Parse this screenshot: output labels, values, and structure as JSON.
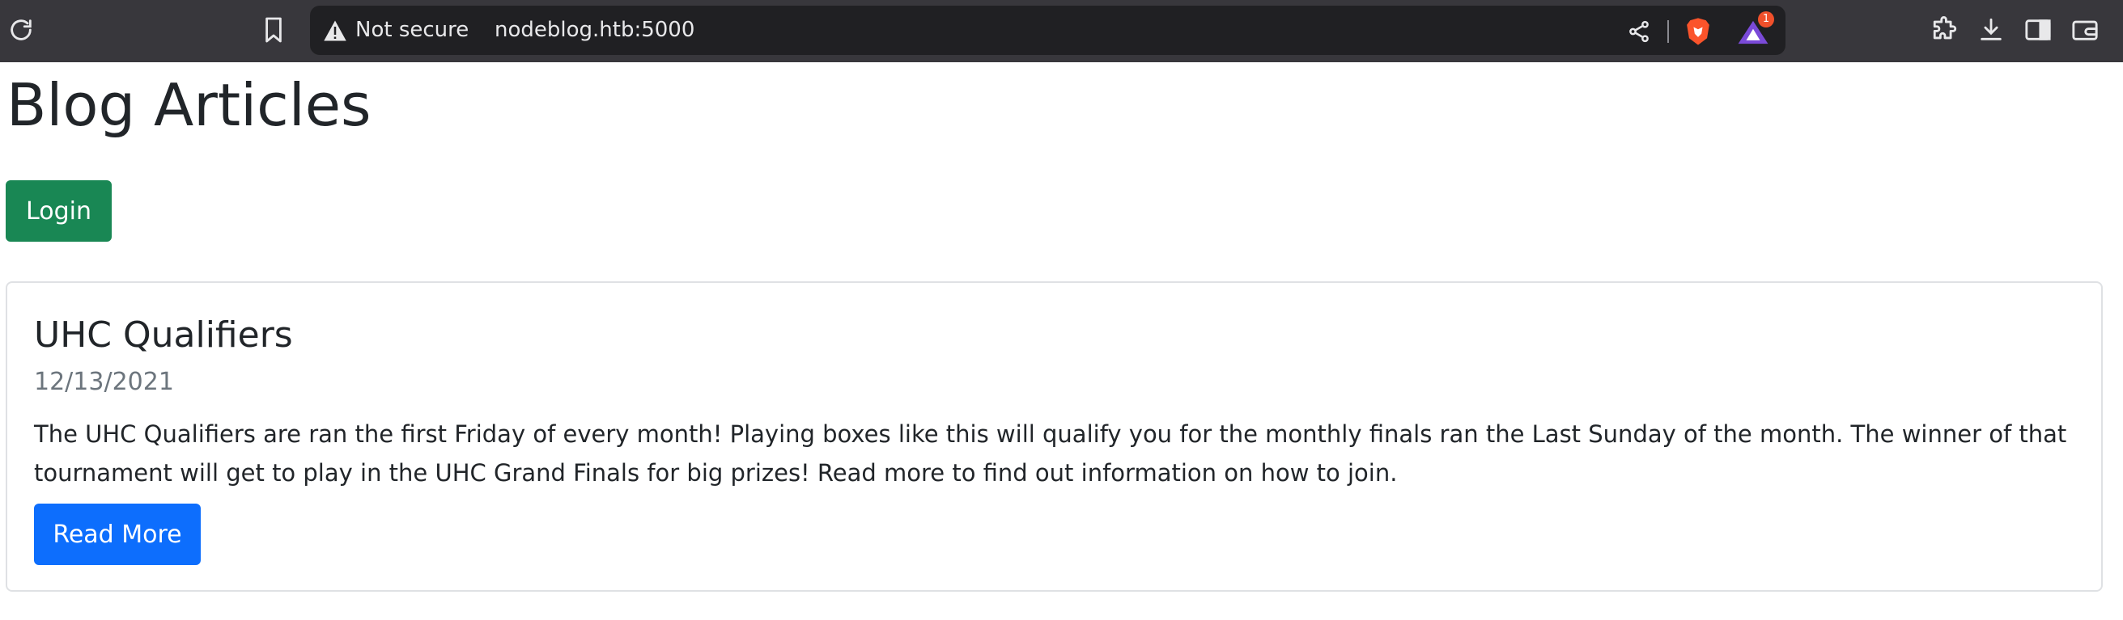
{
  "browser": {
    "security_label": "Not secure",
    "url": "nodeblog.htb:5000",
    "notification_badge": "1"
  },
  "page": {
    "title": "Blog Articles",
    "login_button": "Login"
  },
  "articles": [
    {
      "title": "UHC Qualifiers",
      "date": "12/13/2021",
      "summary": "The UHC Qualifiers are ran the first Friday of every month! Playing boxes like this will qualify you for the monthly finals ran the Last Sunday of the month. The winner of that tournament will get to play in the UHC Grand Finals for big prizes! Read more to find out information on how to join.",
      "button_label": "Read More"
    }
  ],
  "colors": {
    "chrome_bg": "#38373c",
    "urlbar_bg": "#202023",
    "login_green": "#198754",
    "read_more_blue": "#0d6efd",
    "brave_orange": "#fb542b"
  }
}
